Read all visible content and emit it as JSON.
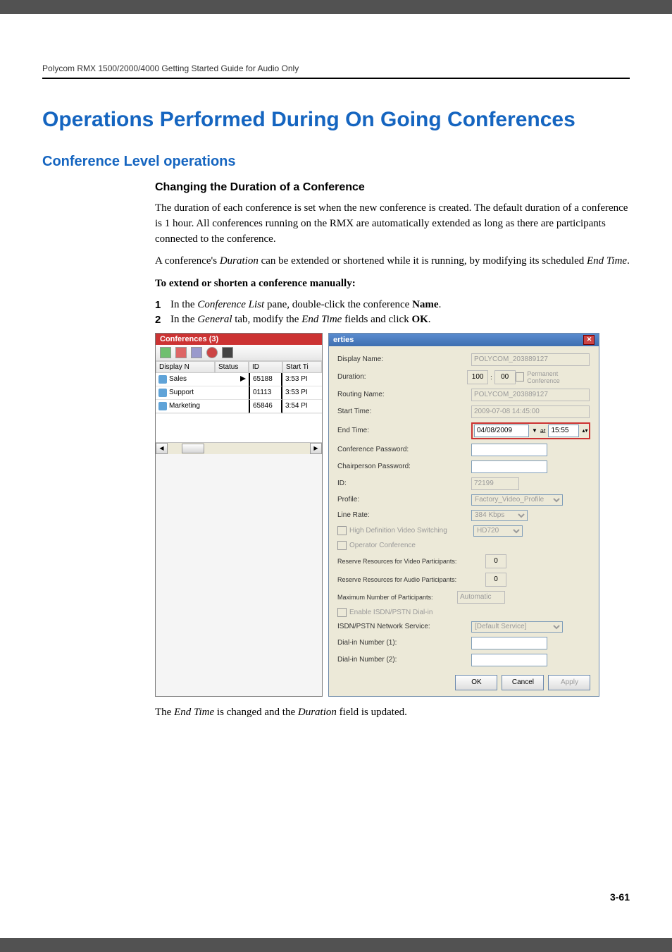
{
  "header": {
    "running": "Polycom RMX 1500/2000/4000 Getting Started Guide for Audio Only"
  },
  "title": "Operations Performed During On Going Conferences",
  "subtitle": "Conference Level operations",
  "section": "Changing the Duration of a Conference",
  "para1": "The duration of each conference is set when the new conference is created. The default duration of a conference is 1 hour. All conferences running on the RMX are automatically extended as long as there are participants connected to the conference.",
  "para2a": "A conference's ",
  "para2b": "Duration",
  "para2c": " can be extended or shortened while it is running, by modifying its scheduled ",
  "para2d": "End Time",
  "para2e": ".",
  "para3": "To extend or shorten a conference manually:",
  "steps": [
    {
      "num": "1",
      "a": "In the ",
      "b": "Conference List",
      "c": " pane, double-click the conference ",
      "d": "Name",
      "e": "."
    },
    {
      "num": "2",
      "a": "In the ",
      "b": "General",
      "c": " tab, modify the ",
      "d": "End Time",
      "e": " fields and click ",
      "f": "OK",
      "g": "."
    }
  ],
  "confList": {
    "title": "Conferences (3)",
    "columns": [
      "Display N",
      "Status",
      "ID",
      "Start Ti"
    ],
    "rows": [
      {
        "name": "Sales",
        "status": "",
        "id": "65188",
        "start": "3:53 PI"
      },
      {
        "name": "Support",
        "status": "",
        "id": "01113",
        "start": "3:53 PI"
      },
      {
        "name": "Marketing",
        "status": "",
        "id": "65846",
        "start": "3:54 PI"
      }
    ],
    "toolbar_icons": [
      "new-icon",
      "delete-icon",
      "properties-icon",
      "rec-icon",
      "stop-icon"
    ]
  },
  "props": {
    "title": "erties",
    "labels": {
      "display_name": "Display Name:",
      "duration": "Duration:",
      "routing_name": "Routing Name:",
      "start_time": "Start Time:",
      "end_time": "End Time:",
      "conf_pw": "Conference Password:",
      "chair_pw": "Chairperson Password:",
      "id": "ID:",
      "profile": "Profile:",
      "line_rate": "Line Rate:",
      "hd": "High Definition Video Switching",
      "op_conf": "Operator Conference",
      "res_video": "Reserve Resources for Video Participants:",
      "res_audio": "Reserve Resources for Audio Participants:",
      "max_part": "Maximum Number of Participants:",
      "enable_isdn": "Enable ISDN/PSTN Dial-in",
      "isdn_svc": "ISDN/PSTN Network Service:",
      "dial1": "Dial-in Number (1):",
      "dial2": "Dial-in Number (2):"
    },
    "values": {
      "display_name": "POLYCOM_203889127",
      "dur_h": "100",
      "dur_m": "00",
      "dur_perm": "Permanent Conference",
      "routing_name": "POLYCOM_203889127",
      "start_time": "2009-07-08 14:45:00",
      "end_date": "04/08/2009",
      "end_at": "at",
      "end_time": "15:55",
      "id": "72199",
      "profile": "Factory_Video_Profile",
      "line_rate": "384 Kbps",
      "hd_res": "HD720",
      "res_video": "0",
      "res_audio": "0",
      "max_part": "Automatic",
      "isdn_svc": "[Default Service]"
    },
    "buttons": {
      "ok": "OK",
      "cancel": "Cancel",
      "apply": "Apply"
    }
  },
  "belowtext": {
    "a": "The ",
    "b": "End Time",
    "c": " is changed and the ",
    "d": "Duration",
    "e": " field is updated."
  },
  "pagenum": "3-61"
}
